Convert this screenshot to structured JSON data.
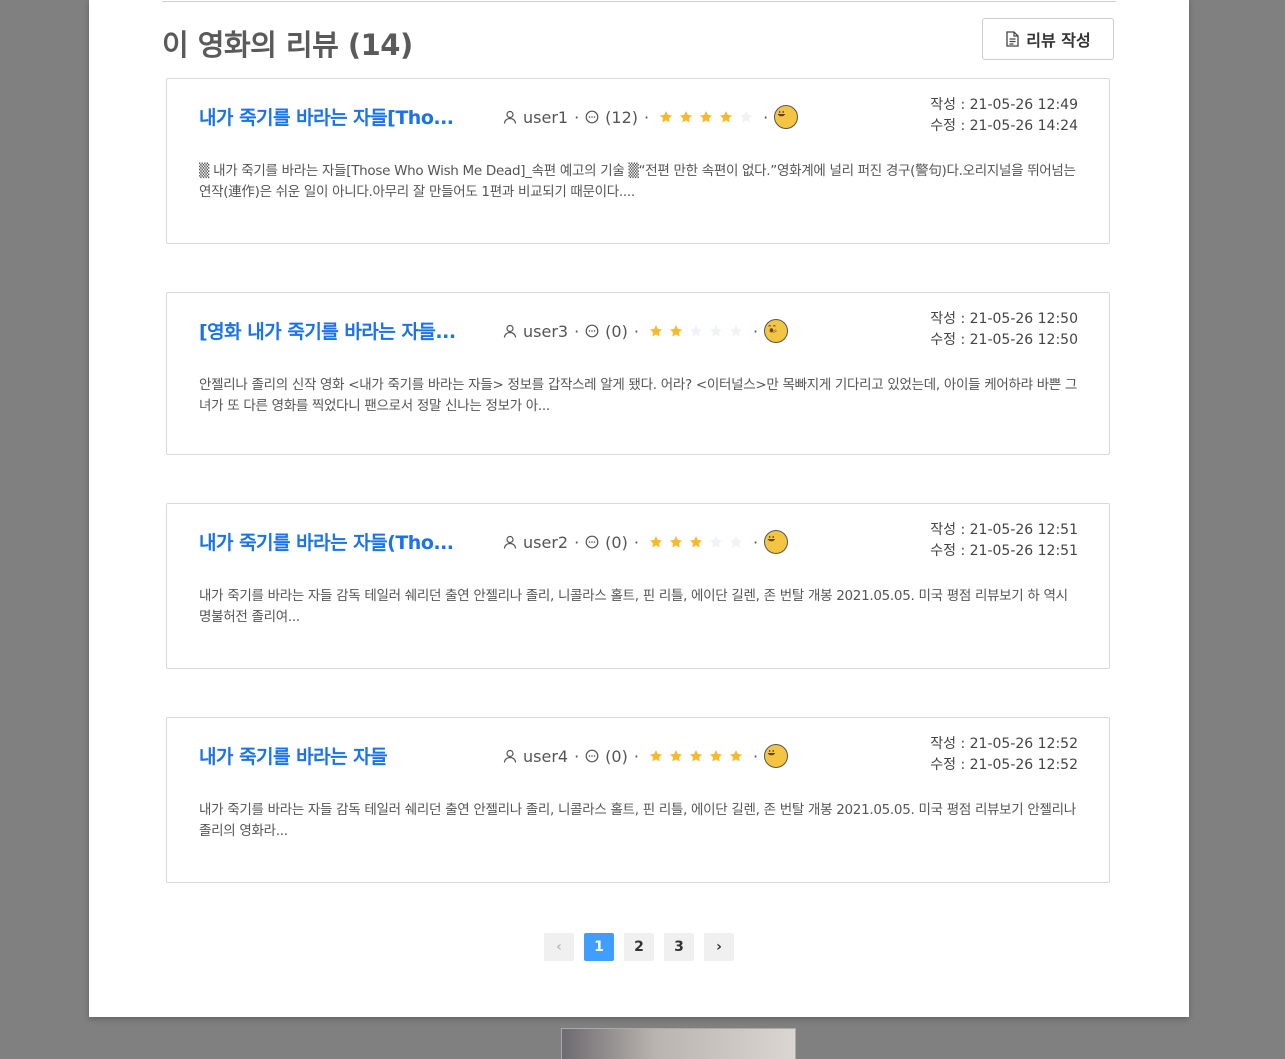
{
  "section": {
    "title": "이 영화의 리뷰 (14)",
    "write_button": "리뷰 작성"
  },
  "reviews": [
    {
      "title": "내가 죽기를 바라는 자들[Tho...",
      "user": "user1",
      "comments": "(12)",
      "rating": 4,
      "emoji": "happy-face",
      "created": "작성 : 21-05-26 12:49",
      "modified": "수정 : 21-05-26 14:24",
      "excerpt": "▒ 내가 죽기를 바라는 자들[Those Who Wish Me Dead]_속편 예고의 기술 ▒“전편 만한 속편이 없다.”영화계에 널리 퍼진 경구(警句)다.오리지널을 뛰어넘는 연작(連作)은 쉬운 일이 아니다.아무리 잘 만들어도 1편과 비교되기 때문이다...."
    },
    {
      "title": "[영화 내가 죽기를 바라는 자들...",
      "user": "user3",
      "comments": "(0)",
      "rating": 2,
      "emoji": "yawning-face",
      "created": "작성 : 21-05-26 12:50",
      "modified": "수정 : 21-05-26 12:50",
      "excerpt": "안젤리나 졸리의 신작 영화 <내가 죽기를 바라는 자들> 정보를 갑작스레 알게 됐다. 어라? <이터널스>만 목빠지게 기다리고 있었는데, 아이들 케어하랴 바쁜 그녀가 또 다른 영화를 찍었다니 팬으로서 정말 신나는 정보가 아..."
    },
    {
      "title": "내가 죽기를 바라는 자들(Tho...",
      "user": "user2",
      "comments": "(0)",
      "rating": 3,
      "emoji": "happy-face",
      "created": "작성 : 21-05-26 12:51",
      "modified": "수정 : 21-05-26 12:51",
      "excerpt": "내가 죽기를 바라는 자들 감독 테일러 쉐리던 출연 안젤리나 졸리, 니콜라스 홀트, 핀 리틀, 에이단 길렌, 존 번탈 개봉 2021.05.05. 미국 평점 리뷰보기 하 역시 명불허전 졸리여..."
    },
    {
      "title": "내가 죽기를 바라는 자들",
      "user": "user4",
      "comments": "(0)",
      "rating": 5,
      "emoji": "happy-face",
      "created": "작성 : 21-05-26 12:52",
      "modified": "수정 : 21-05-26 12:52",
      "excerpt": "내가 죽기를 바라는 자들 감독 테일러 쉐리던 출연 안젤리나 졸리, 니콜라스 홀트, 핀 리틀, 에이단 길렌, 존 번탈 개봉 2021.05.05. 미국 평점 리뷰보기 안젤리나 졸리의 영화라..."
    }
  ],
  "pagination": {
    "prev": "‹",
    "pages": [
      "1",
      "2",
      "3"
    ],
    "current": "1",
    "next": "›"
  },
  "colors": {
    "accent": "#1a73e8",
    "star_on": "#f7ba2a",
    "star_off": "#eff2f7",
    "page_active": "#409eff"
  }
}
